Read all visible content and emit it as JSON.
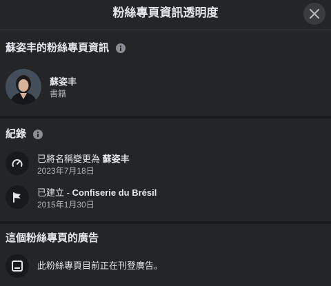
{
  "dialog": {
    "title": "粉絲專頁資訊透明度",
    "close_icon": "close-icon"
  },
  "page_info": {
    "heading": "蘇姿丰的粉絲專頁資訊",
    "name": "蘇姿丰",
    "category": "書籍"
  },
  "history": {
    "heading": "紀錄",
    "items": [
      {
        "icon": "gauge-icon",
        "prefix": "已將名稱變更為 ",
        "value": "蘇姿丰",
        "date": "2023年7月18日"
      },
      {
        "icon": "flag-icon",
        "prefix": "已建立 - ",
        "value": "Confiserie du Brésil",
        "date": "2015年1月30日"
      }
    ]
  },
  "ads": {
    "heading": "這個粉絲專頁的廣告",
    "status": "此粉絲專頁目前正在刊登廣告。"
  },
  "colors": {
    "background": "#242526",
    "divider": "#18191a",
    "text_primary": "#e4e6eb",
    "text_secondary": "#b0b3b8"
  }
}
